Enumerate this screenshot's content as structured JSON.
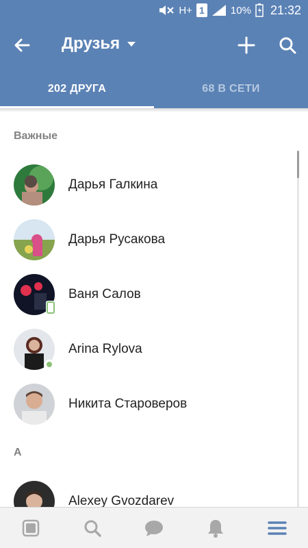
{
  "status_bar": {
    "network_type": "H+",
    "sim_slot": "1",
    "battery_percent": "10%",
    "time": "21:32"
  },
  "app_bar": {
    "title": "Друзья",
    "icons": [
      "back-arrow-icon",
      "dropdown-caret-icon",
      "plus-icon",
      "search-icon"
    ]
  },
  "tabs": [
    {
      "label": "202 ДРУГА",
      "active": true
    },
    {
      "label": "68 В СЕТИ",
      "active": false
    }
  ],
  "sections": [
    {
      "header": "Важные",
      "friends": [
        {
          "name": "Дарья Галкина",
          "status": "none"
        },
        {
          "name": "Дарья Русакова",
          "status": "none"
        },
        {
          "name": "Ваня Салов",
          "status": "mobile"
        },
        {
          "name": "Arina Rylova",
          "status": "online"
        },
        {
          "name": "Никита Староверов",
          "status": "none"
        }
      ]
    },
    {
      "header": "А",
      "friends": [
        {
          "name": "Alexey Gvozdarev",
          "status": "none"
        }
      ]
    }
  ],
  "bottom_nav": [
    "news-icon",
    "search-icon",
    "messages-icon",
    "notifications-icon",
    "menu-icon"
  ],
  "colors": {
    "header_bg": "#5b82b5",
    "online_green": "#8ac176",
    "accent_blue": "#5b82b5"
  }
}
